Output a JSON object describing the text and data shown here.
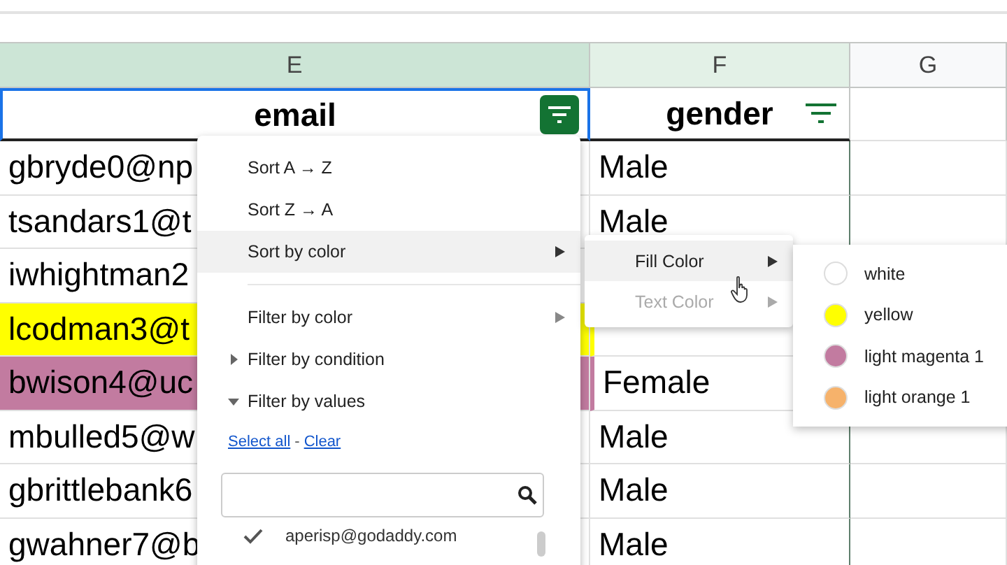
{
  "columns": [
    {
      "letter": "E",
      "selected": true
    },
    {
      "letter": "F",
      "selected": true
    },
    {
      "letter": "G",
      "selected": false
    }
  ],
  "header": [
    {
      "text": "email",
      "filter_active": true
    },
    {
      "text": "gender",
      "filter_active": false
    }
  ],
  "rows": [
    {
      "email": "gbryde0@np",
      "gender": "Male"
    },
    {
      "email": "tsandars1@t",
      "gender": "Male"
    },
    {
      "email": "iwhightman2"
    },
    {
      "email": "lcodman3@t",
      "color": "#ffff00"
    },
    {
      "email": "bwison4@uc",
      "gender": "Female",
      "color": "#c27ba0"
    },
    {
      "email": "mbulled5@w",
      "gender": "Male"
    },
    {
      "email": "gbrittlebank6",
      "gender": "Male"
    },
    {
      "email": "gwahner7@b",
      "gender": "Male"
    }
  ],
  "menu": {
    "items": [
      {
        "kind": "action",
        "label": "Sort A → Z",
        "selected": false
      },
      {
        "kind": "action",
        "label": "Sort Z → A",
        "selected": false
      },
      {
        "kind": "submenu",
        "label": "Sort by color",
        "selected": true
      },
      {
        "kind": "divider"
      },
      {
        "kind": "submenu",
        "label": "Filter by color",
        "selected": false
      },
      {
        "kind": "section",
        "label": "Filter by condition",
        "expanded": false
      },
      {
        "kind": "section",
        "label": "Filter by values",
        "expanded": true
      }
    ],
    "links": [
      "Select all",
      "Clear"
    ],
    "link_separator": "-",
    "values": [
      {
        "label": "aperisp@godaddy.com",
        "checked": true
      }
    ]
  },
  "submenu": [
    {
      "label": "Fill Color",
      "disabled": false,
      "selected": true
    },
    {
      "label": "Text Color",
      "disabled": true,
      "selected": false
    }
  ],
  "colors": [
    {
      "label": "white",
      "color": "#ffffff"
    },
    {
      "label": "yellow",
      "color": "#ffff00"
    },
    {
      "label": "light magenta 1",
      "color": "#c27ba0"
    },
    {
      "label": "light orange 1",
      "color": "#f6b26b"
    }
  ]
}
